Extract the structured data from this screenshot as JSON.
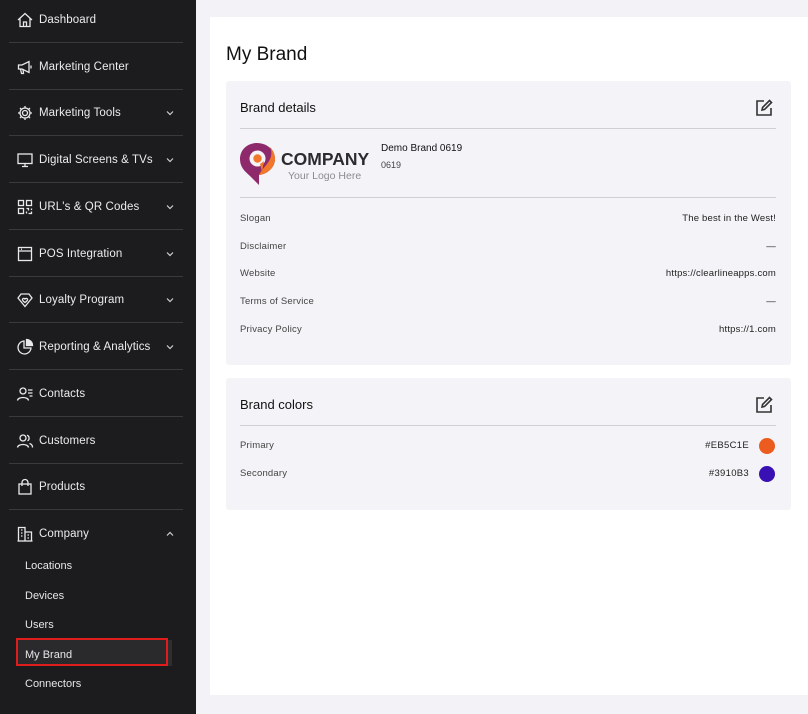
{
  "sidebar": {
    "items": [
      {
        "label": "Dashboard",
        "icon": "home-icon",
        "expandable": false
      },
      {
        "label": "Marketing Center",
        "icon": "megaphone-icon",
        "expandable": false
      },
      {
        "label": "Marketing Tools",
        "icon": "gear-icon",
        "expandable": true
      },
      {
        "label": "Digital Screens & TVs",
        "icon": "monitor-icon",
        "expandable": true
      },
      {
        "label": "URL's & QR Codes",
        "icon": "qr-code-icon",
        "expandable": true
      },
      {
        "label": "POS Integration",
        "icon": "register-icon",
        "expandable": true
      },
      {
        "label": "Loyalty Program",
        "icon": "diamond-heart-icon",
        "expandable": true
      },
      {
        "label": "Reporting & Analytics",
        "icon": "pie-chart-icon",
        "expandable": true
      },
      {
        "label": "Contacts",
        "icon": "contacts-icon",
        "expandable": false
      },
      {
        "label": "Customers",
        "icon": "customers-icon",
        "expandable": false
      },
      {
        "label": "Products",
        "icon": "bag-icon",
        "expandable": false
      },
      {
        "label": "Company",
        "icon": "building-icon",
        "expandable": true,
        "expanded": true
      }
    ],
    "company_sub": [
      "Locations",
      "Devices",
      "Users",
      "My Brand",
      "Connectors"
    ],
    "active_sub": "My Brand"
  },
  "main": {
    "page_title": "My Brand",
    "brand_details": {
      "title": "Brand details",
      "logo": {
        "word": "COMPANY",
        "tagline": "Your Logo Here"
      },
      "brand_name": "Demo Brand 0619",
      "brand_code": "0619",
      "rows": [
        {
          "label": "Slogan",
          "value": "The best in the West!"
        },
        {
          "label": "Disclaimer",
          "value": "—"
        },
        {
          "label": "Website",
          "value": "https://clearlineapps.com"
        },
        {
          "label": "Terms of Service",
          "value": "—"
        },
        {
          "label": "Privacy Policy",
          "value": "https://1.com"
        }
      ]
    },
    "brand_colors": {
      "title": "Brand colors",
      "rows": [
        {
          "label": "Primary",
          "hex": "#EB5C1E",
          "color": "#EB5C1E"
        },
        {
          "label": "Secondary",
          "hex": "#3910B3",
          "color": "#3910B3"
        }
      ]
    }
  },
  "colors": {
    "sidebar_bg": "#1c1c1e",
    "highlight": "#e01b1b",
    "logo_orange": "#f0772b",
    "logo_purple": "#8e2a6c"
  }
}
